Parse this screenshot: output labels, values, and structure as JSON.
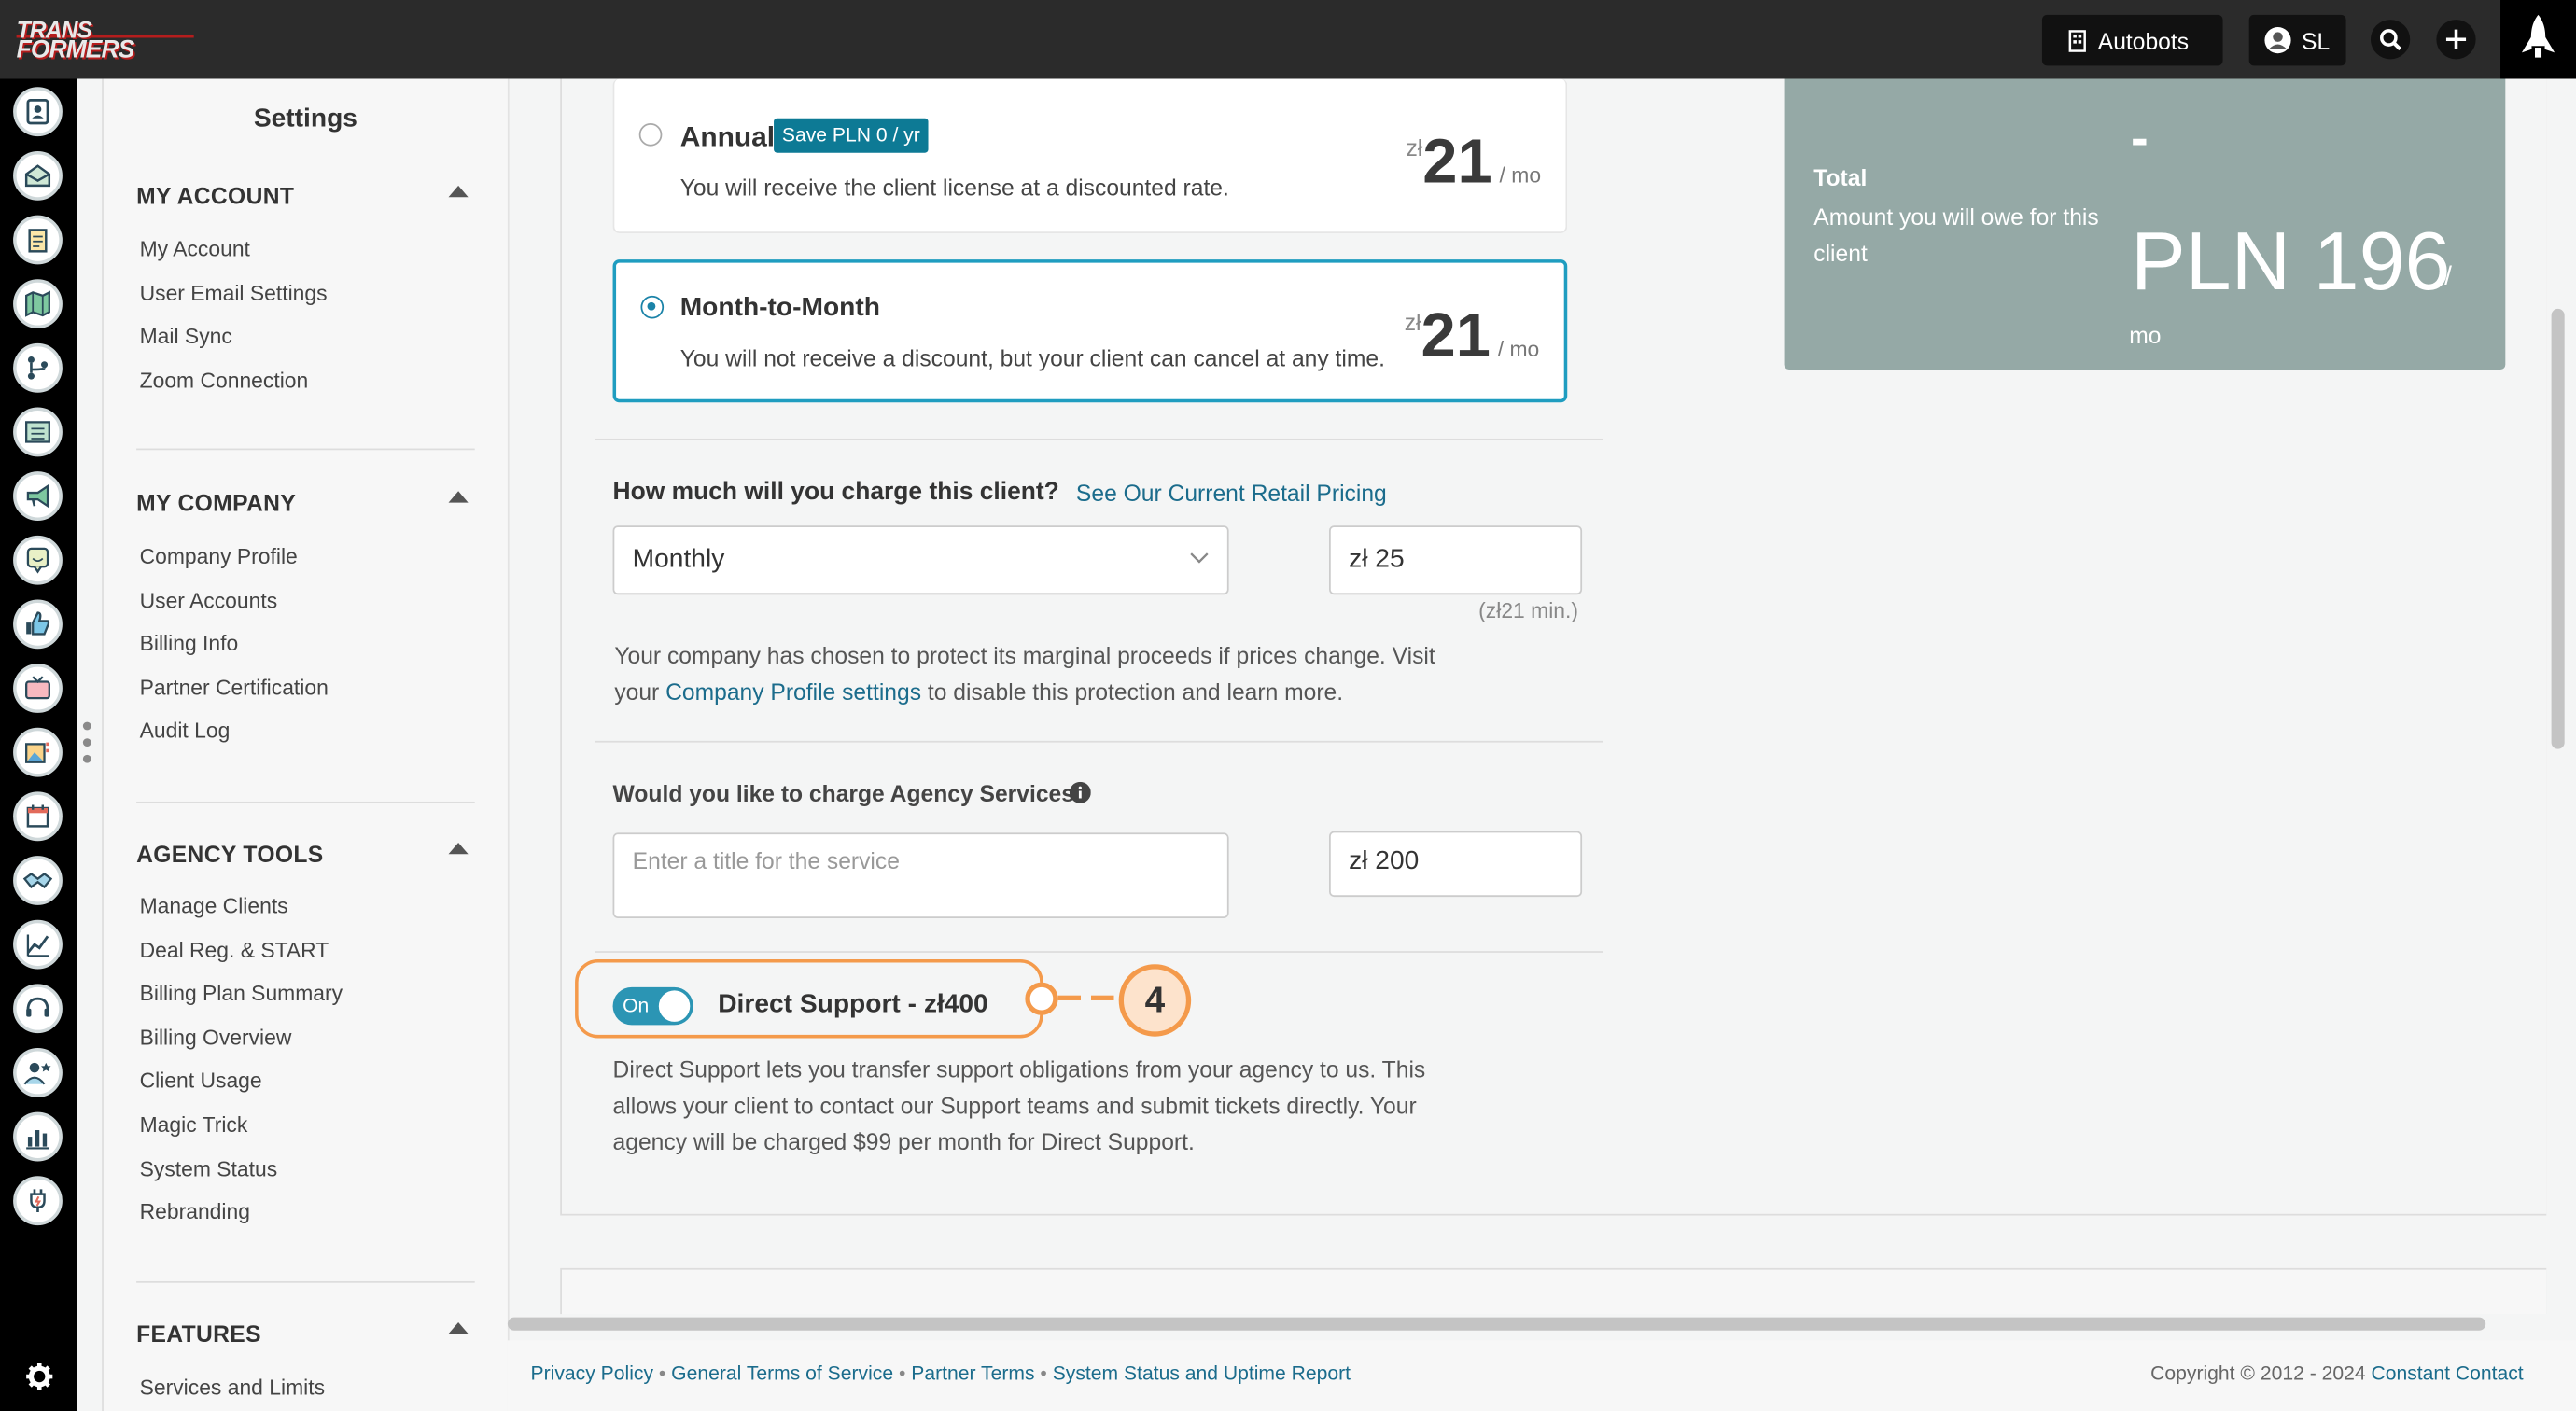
{
  "topbar": {
    "logo_line1": "TRANS",
    "logo_line2": "FORMERS",
    "account_btn": "Autobots",
    "user_initials": "SL"
  },
  "rail_icons": [
    "contacts-icon",
    "email-icon",
    "clipboard-icon",
    "map-icon",
    "flow-icon",
    "list-icon",
    "megaphone-icon",
    "chat-icon",
    "thumbs-up-icon",
    "tv-icon",
    "images-icon",
    "calendar-icon",
    "handshake-icon",
    "trend-icon",
    "headset-icon",
    "user-star-icon",
    "bar-chart-icon",
    "plug-icon"
  ],
  "nav": {
    "title": "Settings",
    "sections": [
      {
        "title": "MY ACCOUNT",
        "items": [
          "My Account",
          "User Email Settings",
          "Mail Sync",
          "Zoom Connection"
        ]
      },
      {
        "title": "MY COMPANY",
        "items": [
          "Company Profile",
          "User Accounts",
          "Billing Info",
          "Partner Certification",
          "Audit Log"
        ]
      },
      {
        "title": "AGENCY TOOLS",
        "items": [
          "Manage Clients",
          "Deal Reg. & START",
          "Billing Plan Summary",
          "Billing Overview",
          "Client Usage",
          "Magic Trick",
          "System Status",
          "Rebranding"
        ]
      },
      {
        "title": "FEATURES",
        "items": [
          "Services and Limits"
        ]
      }
    ]
  },
  "plans": {
    "annual": {
      "title": "Annual",
      "badge": "Save PLN 0 / yr",
      "desc": "You will receive the client license at a discounted rate.",
      "currency": "zł",
      "amount": "21",
      "per": "/ mo"
    },
    "monthly": {
      "title": "Month-to-Month",
      "desc": "You will not receive a discount, but your client can cancel at any time.",
      "currency": "zł",
      "amount": "21",
      "per": "/ mo",
      "selected": true
    }
  },
  "charge": {
    "question": "How much will you charge this client?",
    "link": "See Our Current Retail Pricing",
    "frequency": "Monthly",
    "amount": "zł 25",
    "min_note": "(zł21 min.)",
    "note_before": "Your company has chosen to protect its marginal proceeds if prices change. Visit your",
    "note_link": "Company Profile settings",
    "note_after": "to disable this protection and learn more."
  },
  "agency": {
    "question": "Would you like to charge Agency Services?",
    "title_placeholder": "Enter a title for the service",
    "amount": "zł 200"
  },
  "direct_support": {
    "toggle_label": "On",
    "title": "Direct Support - zł400",
    "desc": "Direct Support lets you transfer support obligations from your agency to us. This allows your client to contact our Support teams and submit tickets directly. Your agency will be charged $99 per month for Direct Support.",
    "callout_number": "4"
  },
  "total": {
    "label": "Total",
    "sub": "Amount you will owe for this client",
    "dash": "-",
    "amount": "PLN 196",
    "per_slash": "/",
    "per": "mo"
  },
  "footer": {
    "links": [
      "Privacy Policy",
      "General Terms of Service",
      "Partner Terms",
      "System Status and Uptime Report"
    ],
    "copyright": "Copyright © 2012 - 2024",
    "copyright_link": "Constant Contact"
  },
  "colors": {
    "accent": "#1b83a8",
    "callout": "#f49a4b",
    "total_bg": "#95a9a6"
  }
}
